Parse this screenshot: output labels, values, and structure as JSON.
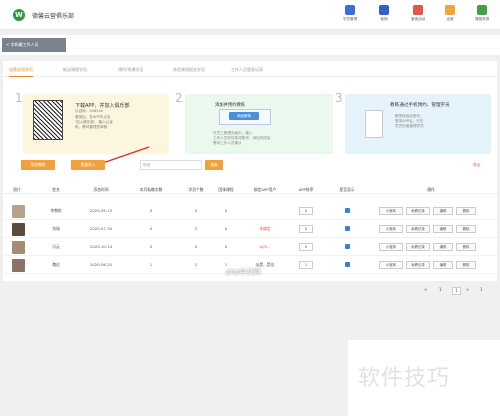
{
  "brand": "德馨云营俱乐部",
  "toolbar": [
    {
      "label": "学员管理",
      "icon": "people-icon",
      "color": "#3a6fd8"
    },
    {
      "label": "营销",
      "icon": "megaphone-icon",
      "color": "#2f63c9"
    },
    {
      "label": "营销活动",
      "icon": "gift-icon",
      "color": "#e0584a"
    },
    {
      "label": "运营",
      "icon": "chart-icon",
      "color": "#f2a33a"
    },
    {
      "label": "课程资源",
      "icon": "book-icon",
      "color": "#43a047"
    }
  ],
  "back_button": "< 学和藏工作人员",
  "tabs": [
    "该营业组学员",
    "推送课程学员",
    "预约/排课学员",
    "体验课程报名学员",
    "工作人员登录记录"
  ],
  "steps": {
    "s1": {
      "num": "1",
      "title": "下载APP，并加入俱乐部",
      "lines": [
        "认证码：408540",
        "登录后，在APP中点击",
        "'加入俱乐部'，输入认证",
        "码，等待管理员审核"
      ]
    },
    "s2": {
      "num": "2",
      "title": "添加并预约教练",
      "button": "添加教练",
      "lines": [
        "在员工管理页面中，输入",
        "工作人员的信息或账号，添加完成后",
        "等待工作人员确认"
      ]
    },
    "s3": {
      "num": "3",
      "title": "教练通过手机预约、管理学员",
      "lines": [
        "教练使用此账号，",
        "登录APP后，可在",
        "学员页面管理学员"
      ]
    }
  },
  "actions": {
    "add": "添加教练",
    "batch": "批量导入",
    "search_placeholder": "搜索",
    "search": "搜索",
    "export": "导出"
  },
  "table": {
    "headers": [
      "照片",
      "姓名",
      "添加时间",
      "本月私教次数",
      "学员个数",
      "团体课程",
      "绑定APP用户",
      "APP排序",
      "是否显示",
      "操作"
    ],
    "rows": [
      {
        "name": "李教练",
        "date": "2020-05-13",
        "monthly": "0",
        "students": "0",
        "group": "0",
        "app_user": "",
        "app_user_red": false,
        "rank": "0",
        "avatar": "#b7a38a"
      },
      {
        "name": "张瑞",
        "date": "2020-07-30",
        "monthly": "0",
        "students": "2",
        "group": "0",
        "app_user": "未绑定",
        "app_user_red": true,
        "rank": "0",
        "avatar": "#5c4a3a"
      },
      {
        "name": "冯云",
        "date": "2020-10-14",
        "monthly": "0",
        "students": "0",
        "group": "0",
        "app_user": "以/9...",
        "app_user_red": true,
        "rank": "0",
        "avatar": "#a58d74"
      },
      {
        "name": "魏佳",
        "date": "2020-06-20",
        "monthly": "1",
        "students": "2",
        "group": "1",
        "app_user": "似是...是佳",
        "app_user_red": false,
        "rank": "1",
        "avatar": "#8a7466"
      }
    ],
    "row_buttons": [
      "小程序",
      "私教记录",
      "编辑",
      "删除"
    ]
  },
  "pager": {
    "prev": "<",
    "first": "1",
    "current": "1",
    "next": ">",
    "total": "1"
  },
  "watermark": "软件技巧",
  "badge": "php中文网"
}
